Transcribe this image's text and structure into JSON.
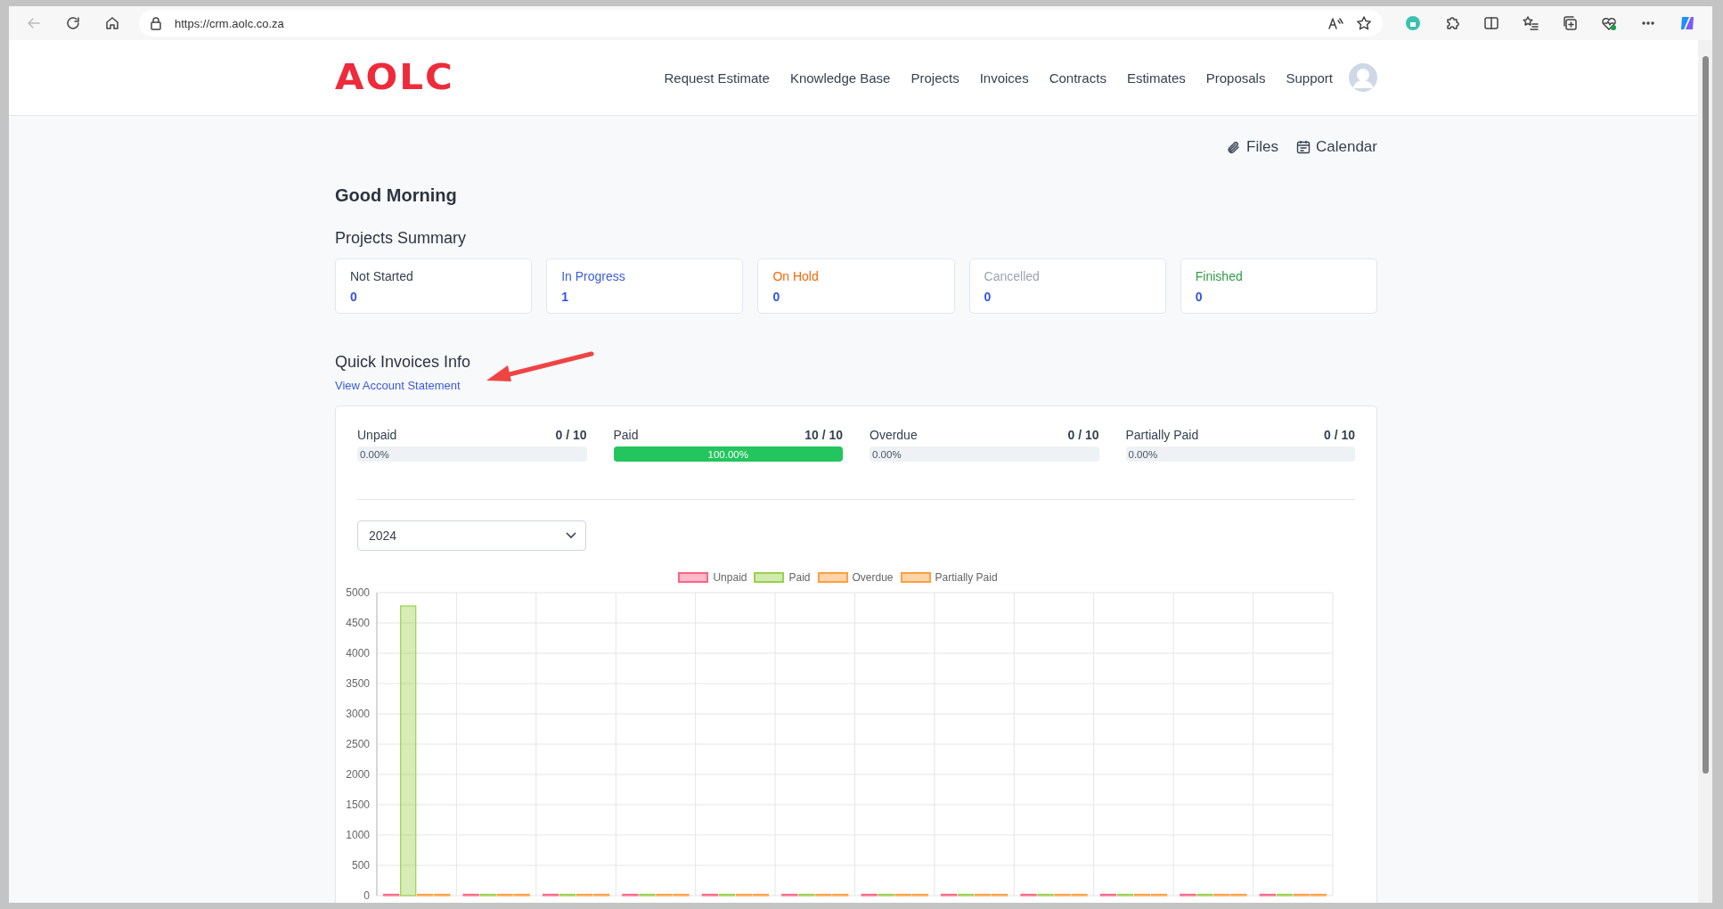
{
  "browser": {
    "url": "https://crm.aolc.co.za"
  },
  "header": {
    "logo": "AOLC",
    "nav": [
      "Request Estimate",
      "Knowledge Base",
      "Projects",
      "Invoices",
      "Contracts",
      "Estimates",
      "Proposals",
      "Support"
    ]
  },
  "quick_links": [
    "Files",
    "Calendar"
  ],
  "greeting": "Good Morning",
  "projects_summary": {
    "title": "Projects Summary",
    "cards": [
      {
        "label": "Not Started",
        "value": "0",
        "color": "#374151"
      },
      {
        "label": "In Progress",
        "value": "1",
        "color": "#3b5bdb"
      },
      {
        "label": "On Hold",
        "value": "0",
        "color": "#f76707"
      },
      {
        "label": "Cancelled",
        "value": "0",
        "color": "#9aa3b2"
      },
      {
        "label": "Finished",
        "value": "0",
        "color": "#2f9e44"
      }
    ]
  },
  "quick_invoices": {
    "title": "Quick Invoices Info",
    "link": "View Account Statement",
    "stats": [
      {
        "name": "Unpaid",
        "count": "0 / 10",
        "level": 0,
        "percent": "0.00%"
      },
      {
        "name": "Paid",
        "count": "10 / 10",
        "level": 1,
        "percent": "100.00%"
      },
      {
        "name": "Overdue",
        "count": "0 / 10",
        "level": 0,
        "percent": "0.00%"
      },
      {
        "name": "Partially Paid",
        "count": "0 / 10",
        "level": 0,
        "percent": "0.00%"
      }
    ],
    "year_select": {
      "value": "2024"
    },
    "chart_data": {
      "type": "bar",
      "grid": true,
      "ylim": [
        0,
        5000
      ],
      "yticks": [
        0,
        500,
        1000,
        1500,
        2000,
        2500,
        3000,
        3500,
        4000,
        4500,
        5000
      ],
      "series": [
        {
          "name": "Unpaid",
          "color": "#ff6384",
          "values": [
            0,
            0,
            0,
            0,
            0,
            0,
            0,
            0,
            0,
            0,
            0,
            0
          ]
        },
        {
          "name": "Paid",
          "color": "#9ad04b",
          "values": [
            4780,
            0,
            0,
            0,
            0,
            0,
            0,
            0,
            0,
            0,
            0,
            0
          ]
        },
        {
          "name": "Overdue",
          "color": "#ff9f40",
          "values": [
            0,
            0,
            0,
            0,
            0,
            0,
            0,
            0,
            0,
            0,
            0,
            0
          ]
        },
        {
          "name": "Partially Paid",
          "color": "#ff9f40",
          "values": [
            0,
            0,
            0,
            0,
            0,
            0,
            0,
            0,
            0,
            0,
            0,
            0
          ]
        }
      ]
    }
  }
}
